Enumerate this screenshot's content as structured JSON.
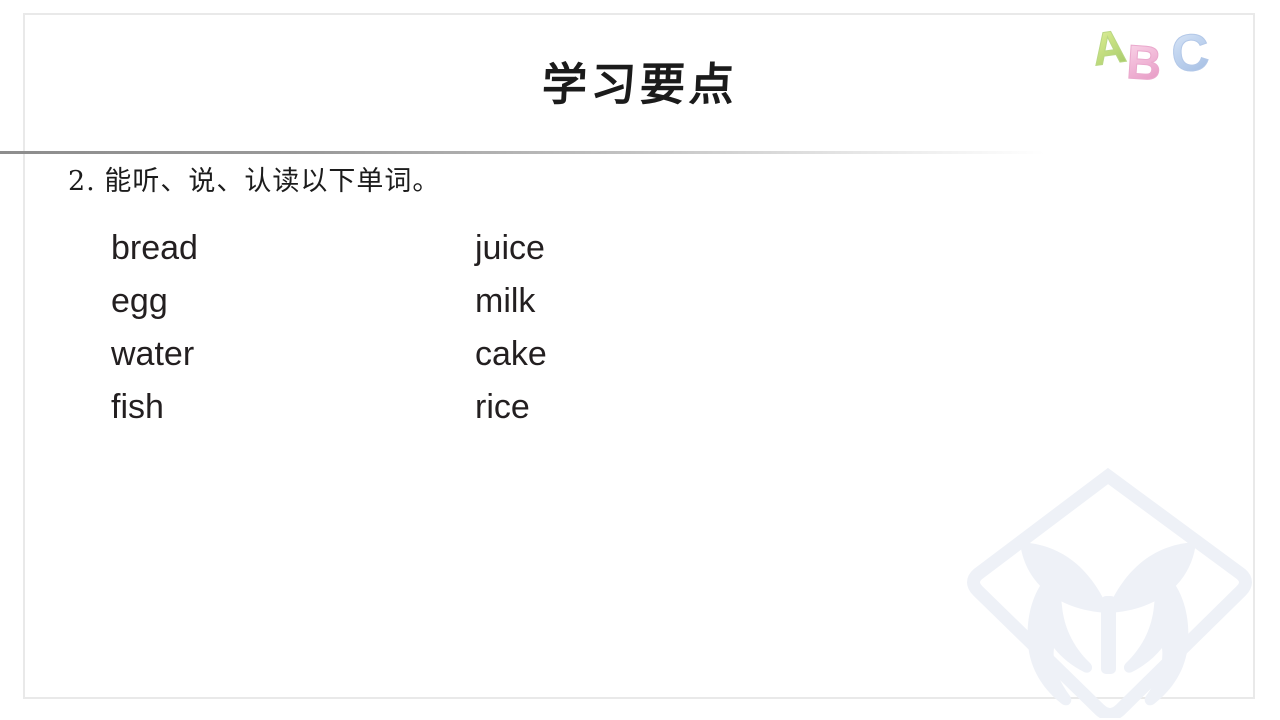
{
  "header": {
    "title": "学习要点",
    "logo_alt": "ABC",
    "logo_letters": [
      {
        "char": "A",
        "color": "#c9e08a"
      },
      {
        "char": "B",
        "color": "#f2b9d8"
      },
      {
        "char": "C",
        "color": "#bfd2ee"
      }
    ]
  },
  "body": {
    "bullet_number": "2.",
    "bullet_text": "能听、说、认读以下单词。",
    "word_rows": [
      {
        "left": "bread",
        "right": "juice"
      },
      {
        "left": "egg",
        "right": "milk"
      },
      {
        "left": "water",
        "right": "cake"
      },
      {
        "left": "fish",
        "right": "rice"
      }
    ]
  },
  "watermark": {
    "name": "hands-holding-sprout-logo",
    "color": "#eef1f7"
  },
  "colors": {
    "background": "#ffffff",
    "frame": "#e9e9e9",
    "rule": "#8d8d8d",
    "text": "#231f20",
    "title": "#1b1b1b"
  }
}
